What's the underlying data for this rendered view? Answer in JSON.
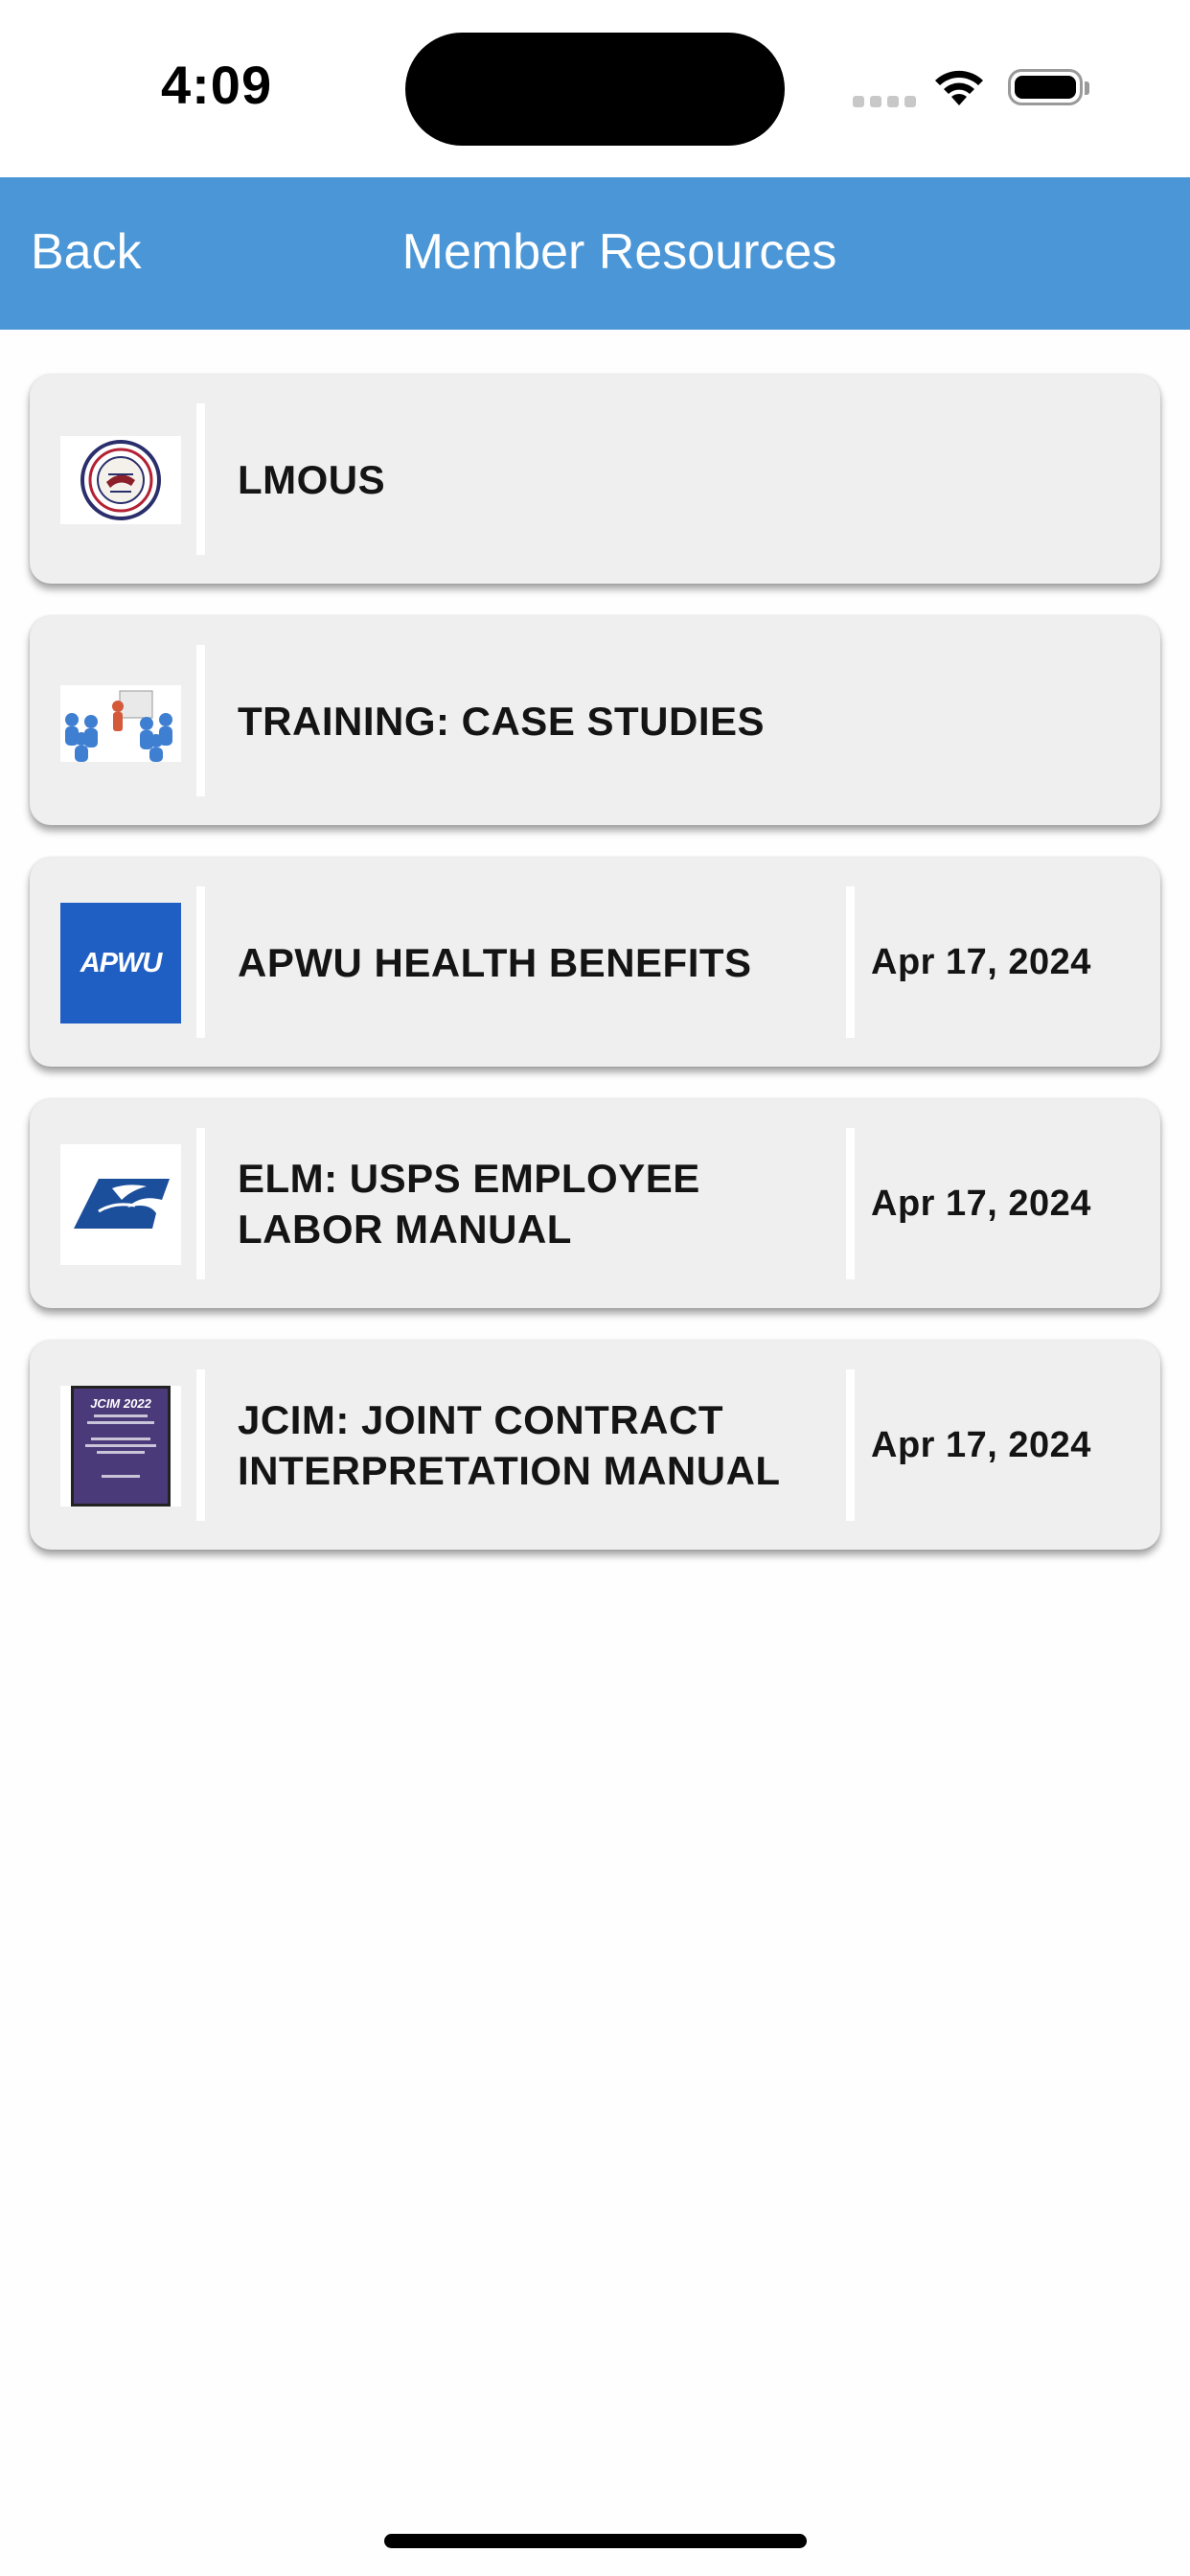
{
  "status_bar": {
    "time": "4:09"
  },
  "nav": {
    "back_label": "Back",
    "title": "Member Resources"
  },
  "resources": [
    {
      "title": "LMOUS",
      "date": ""
    },
    {
      "title": "TRAINING: CASE STUDIES",
      "date": ""
    },
    {
      "title": "APWU HEALTH BENEFITS",
      "date": "Apr 17, 2024",
      "thumb_text": "APWU"
    },
    {
      "title": "ELM: USPS EMPLOYEE LABOR MANUAL",
      "date": "Apr 17, 2024"
    },
    {
      "title": "JCIM: JOINT CONTRACT INTERPRETATION MANUAL",
      "date": "Apr 17, 2024",
      "thumb_text": "JCIM 2022"
    }
  ],
  "colors": {
    "nav_bar": "#4a96d7",
    "card_background": "#efeff0",
    "apwu_blue": "#1f5fc4",
    "usps_blue": "#1b4f9c",
    "jcim_purple": "#4b3a7a"
  }
}
